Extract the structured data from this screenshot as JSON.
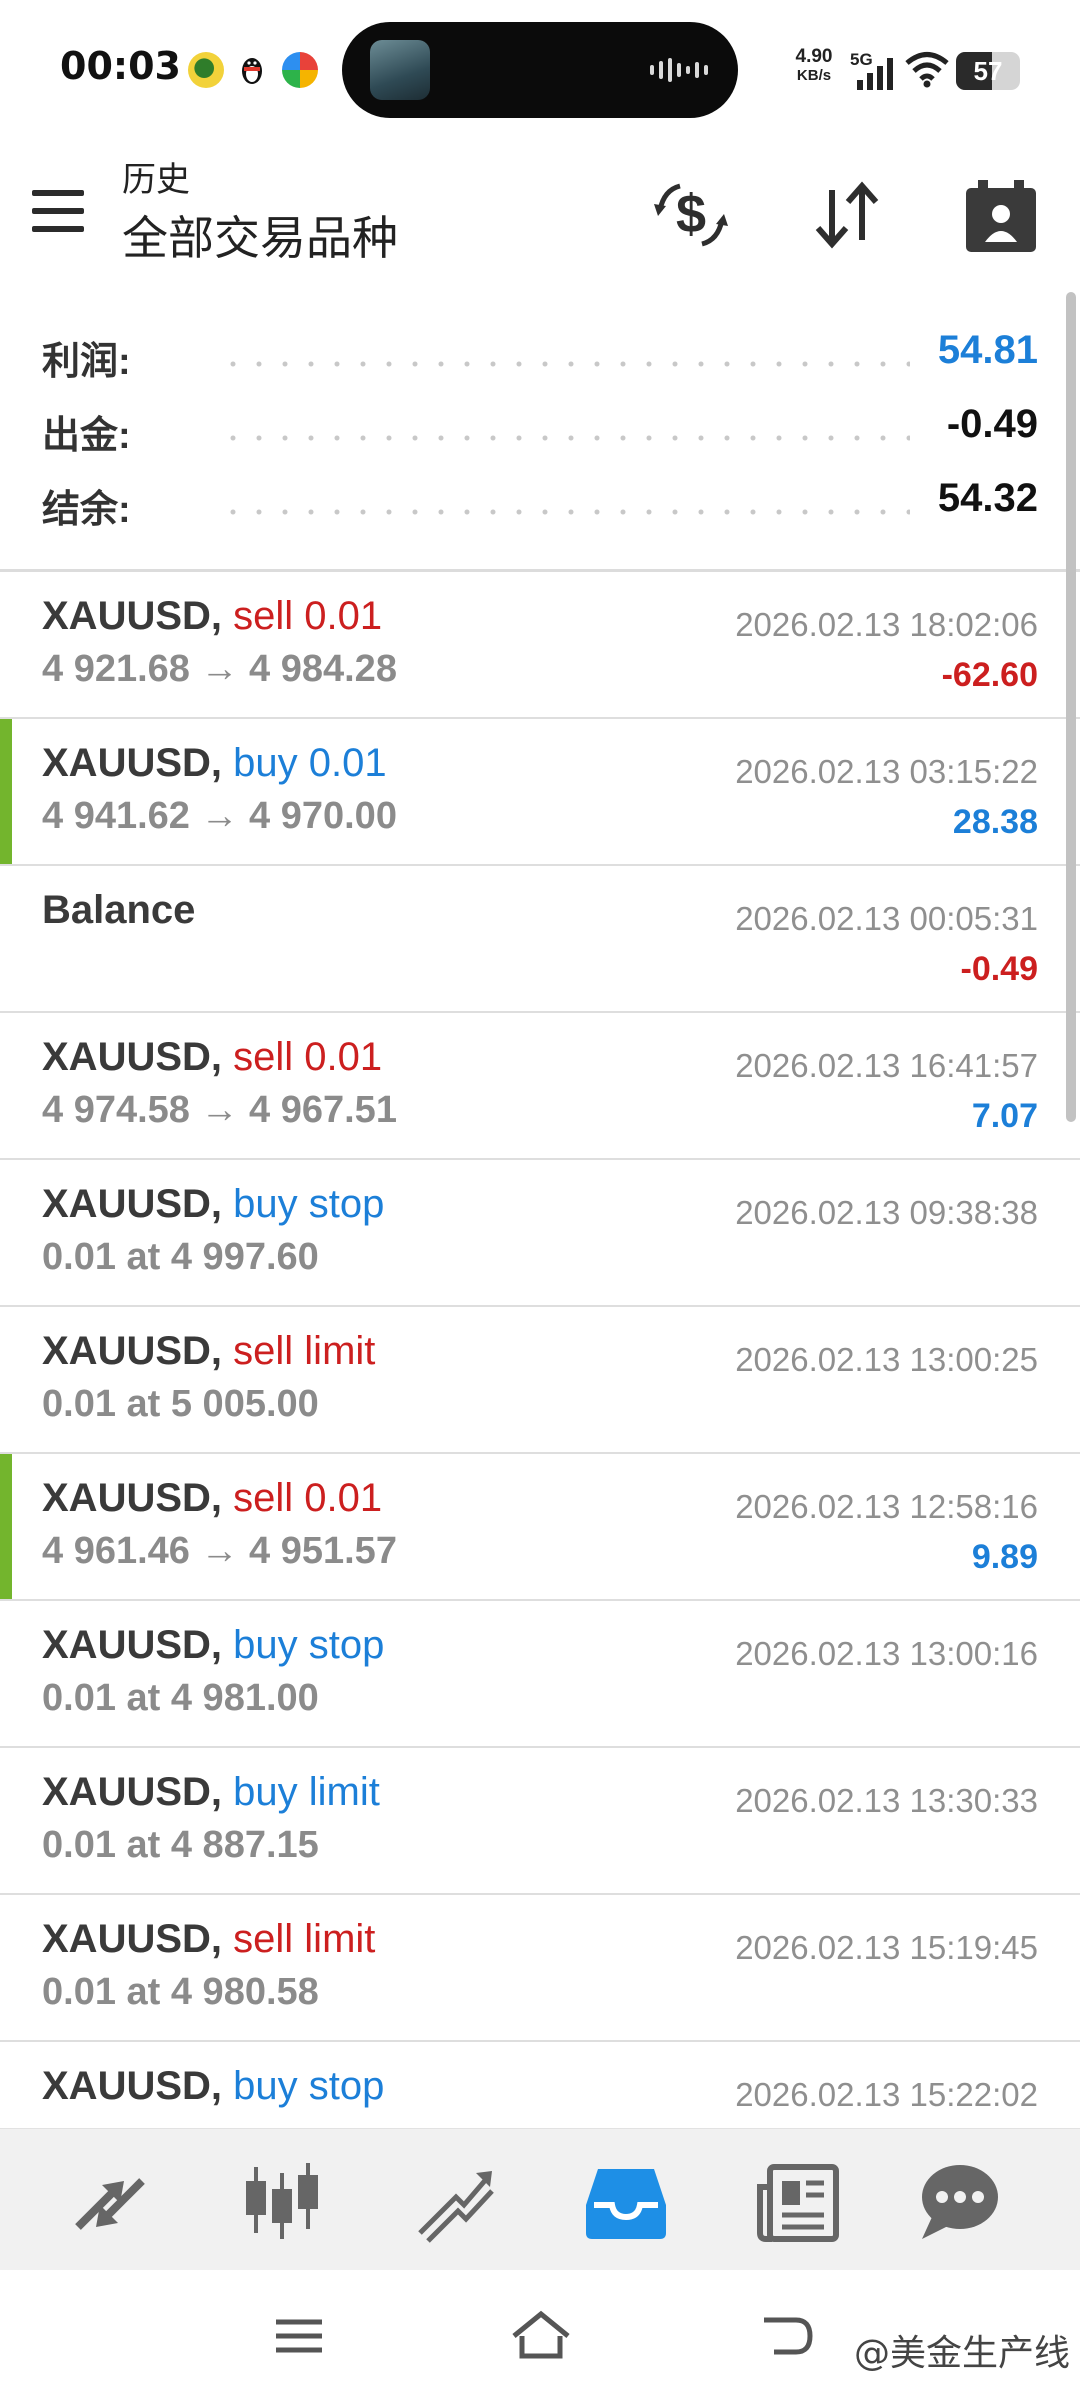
{
  "status_bar": {
    "time": "00:03",
    "net_speed_value": "4.90",
    "net_speed_unit": "KB/s",
    "network_type": "5G",
    "battery": "57",
    "battery_level": 0.57,
    "app_icons": [
      "green-app-icon",
      "penguin-icon",
      "colorful-app-icon"
    ]
  },
  "toolbar": {
    "title_small": "历史",
    "title_big": "全部交易品种",
    "icons": [
      "currency-exchange-icon",
      "sort-icon",
      "calendar-person-icon"
    ]
  },
  "summary": {
    "profit_label": "利润:",
    "profit_value": "54.81",
    "withdrawal_label": "出金:",
    "withdrawal_value": "-0.49",
    "balance_label": "结余:",
    "balance_value": "54.32"
  },
  "colors": {
    "blue": "#1c7fd8",
    "red": "#cc1f1f",
    "gray": "#8b8b8b",
    "accent_green": "#73b52d"
  },
  "deals": [
    {
      "symbol": "XAUUSD,",
      "action": "sell 0.01",
      "action_color": "red",
      "detail": "4 921.68 → 4 984.28",
      "time": "2026.02.13 18:02:06",
      "profit": "-62.60",
      "profit_color": "red",
      "accent": false
    },
    {
      "symbol": "XAUUSD,",
      "action": "buy 0.01",
      "action_color": "blue",
      "detail": "4 941.62 → 4 970.00",
      "time": "2026.02.13 03:15:22",
      "profit": "28.38",
      "profit_color": "blue",
      "accent": true
    },
    {
      "symbol": "Balance",
      "action": "",
      "action_color": "blue",
      "detail": "",
      "time": "2026.02.13 00:05:31",
      "profit": "-0.49",
      "profit_color": "red",
      "accent": false
    },
    {
      "symbol": "XAUUSD,",
      "action": "sell 0.01",
      "action_color": "red",
      "detail": "4 974.58 → 4 967.51",
      "time": "2026.02.13 16:41:57",
      "profit": "7.07",
      "profit_color": "blue",
      "accent": false
    },
    {
      "symbol": "XAUUSD,",
      "action": "buy stop",
      "action_color": "blue",
      "detail": "0.01 at 4 997.60",
      "time": "2026.02.13 09:38:38",
      "profit": "",
      "profit_color": "blue",
      "accent": false
    },
    {
      "symbol": "XAUUSD,",
      "action": "sell limit",
      "action_color": "red",
      "detail": "0.01 at 5 005.00",
      "time": "2026.02.13 13:00:25",
      "profit": "",
      "profit_color": "blue",
      "accent": false
    },
    {
      "symbol": "XAUUSD,",
      "action": "sell 0.01",
      "action_color": "red",
      "detail": "4 961.46 → 4 951.57",
      "time": "2026.02.13 12:58:16",
      "profit": "9.89",
      "profit_color": "blue",
      "accent": true
    },
    {
      "symbol": "XAUUSD,",
      "action": "buy stop",
      "action_color": "blue",
      "detail": "0.01 at 4 981.00",
      "time": "2026.02.13 13:00:16",
      "profit": "",
      "profit_color": "blue",
      "accent": false
    },
    {
      "symbol": "XAUUSD,",
      "action": "buy limit",
      "action_color": "blue",
      "detail": "0.01 at 4 887.15",
      "time": "2026.02.13 13:30:33",
      "profit": "",
      "profit_color": "blue",
      "accent": false
    },
    {
      "symbol": "XAUUSD,",
      "action": "sell limit",
      "action_color": "red",
      "detail": "0.01 at 4 980.58",
      "time": "2026.02.13 15:19:45",
      "profit": "",
      "profit_color": "blue",
      "accent": false
    },
    {
      "symbol": "XAUUSD,",
      "action": "buy stop",
      "action_color": "blue",
      "detail": "",
      "time": "2026.02.13 15:22:02",
      "profit": "",
      "profit_color": "blue",
      "accent": false
    }
  ],
  "bottom_nav": {
    "items": [
      "quotes-icon",
      "chart-icon",
      "trade-icon",
      "history-icon",
      "news-icon",
      "messages-icon"
    ],
    "active_index": 3,
    "active_color": "#1e8fe6",
    "inactive_color": "#666666"
  },
  "system_nav": {
    "items": [
      "menu-icon",
      "home-icon",
      "back-icon"
    ],
    "watermark": "@美金生产线"
  }
}
